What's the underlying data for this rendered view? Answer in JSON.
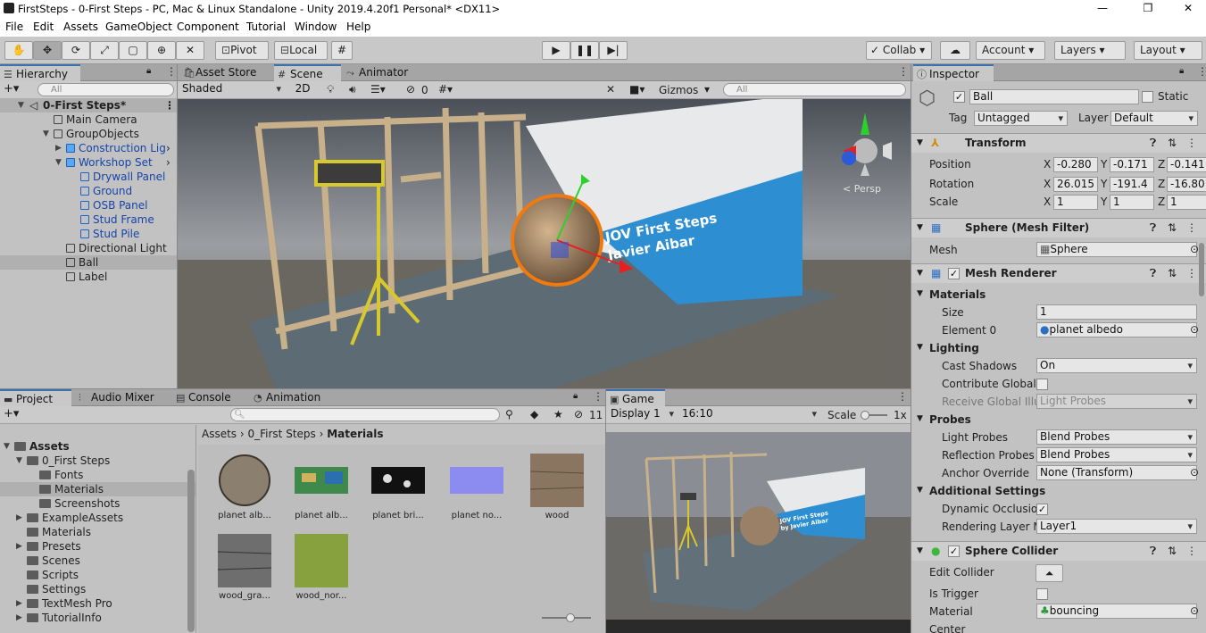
{
  "window": {
    "title": "FirstSteps - 0-First Steps - PC, Mac & Linux Standalone - Unity 2019.4.20f1 Personal* <DX11>",
    "min": "—",
    "max": "❐",
    "close": "✕"
  },
  "menu": [
    "File",
    "Edit",
    "Assets",
    "GameObject",
    "Component",
    "Tutorial",
    "Window",
    "Help"
  ],
  "toolbar": {
    "pivot": "Pivot",
    "local": "Local",
    "collab": "Collab",
    "account": "Account",
    "layers": "Layers",
    "layout": "Layout"
  },
  "hierarchy": {
    "tab": "Hierarchy",
    "search": "All",
    "scene": "0-First Steps*",
    "rows": [
      "Main Camera",
      "GroupObjects",
      "Construction Lig",
      "Workshop Set",
      "Drywall Panel",
      "Ground",
      "OSB Panel",
      "Stud Frame",
      "Stud Pile",
      "Directional Light",
      "Ball",
      "Label"
    ]
  },
  "scene": {
    "tabs": [
      "Asset Store",
      "Scene",
      "Animator"
    ],
    "shading": "Shaded",
    "mode2d": "2D",
    "fx_count": "0",
    "gizmos": "Gizmos",
    "search": "All",
    "persp": "< Persp",
    "sign": [
      "JOV First Steps",
      "Javier Aibar"
    ]
  },
  "project": {
    "tabs": [
      "Project",
      "Audio Mixer",
      "Console",
      "Animation"
    ],
    "hidden_count": "11",
    "tree": [
      "Assets",
      "0_First Steps",
      "Fonts",
      "Materials",
      "Screenshots",
      "ExampleAssets",
      "Materials",
      "Presets",
      "Scenes",
      "Scripts",
      "Settings",
      "TextMesh Pro",
      "TutorialInfo"
    ],
    "breadcrumb": [
      "Assets",
      "0_First Steps",
      "Materials"
    ],
    "assets": [
      "planet alb...",
      "planet alb...",
      "planet bri...",
      "planet no...",
      "wood",
      "wood_gra...",
      "wood_nor..."
    ]
  },
  "game": {
    "tab": "Game",
    "display": "Display 1",
    "aspect": "16:10",
    "scale_label": "Scale",
    "scale_value": "1x",
    "sign": [
      "JOV First Steps",
      "by Javier Aibar"
    ]
  },
  "inspector": {
    "tab": "Inspector",
    "name": "Ball",
    "static": "Static",
    "tag_label": "Tag",
    "tag": "Untagged",
    "layer_label": "Layer",
    "layer": "Default",
    "transform": {
      "title": "Transform",
      "position": "Position",
      "rotation": "Rotation",
      "scale": "Scale",
      "px": "-0.280",
      "py": "-0.171",
      "pz": "-0.141",
      "rx": "26.015",
      "ry": "-191.4",
      "rz": "-16.80",
      "sx": "1",
      "sy": "1",
      "sz": "1"
    },
    "meshfilter": {
      "title": "Sphere (Mesh Filter)",
      "mesh_label": "Mesh",
      "mesh": "Sphere"
    },
    "renderer": {
      "title": "Mesh Renderer",
      "materials": "Materials",
      "size_label": "Size",
      "size": "1",
      "element_label": "Element 0",
      "element": "planet albedo",
      "lighting": "Lighting",
      "cast_label": "Cast Shadows",
      "cast": "On",
      "contrib_label": "Contribute Global I",
      "receive_label": "Receive Global Illu",
      "receive": "Light Probes",
      "probes": "Probes",
      "lightprobes_label": "Light Probes",
      "lightprobes": "Blend Probes",
      "reflection_label": "Reflection Probes",
      "reflection": "Blend Probes",
      "anchor_label": "Anchor Override",
      "anchor": "None (Transform)",
      "additional": "Additional Settings",
      "dynamic_label": "Dynamic Occlusio",
      "layer_label": "Rendering Layer M",
      "layer": "Layer1"
    },
    "collider": {
      "title": "Sphere Collider",
      "edit_label": "Edit Collider",
      "trigger_label": "Is Trigger",
      "material_label": "Material",
      "material": "bouncing",
      "center_label": "Center"
    }
  }
}
